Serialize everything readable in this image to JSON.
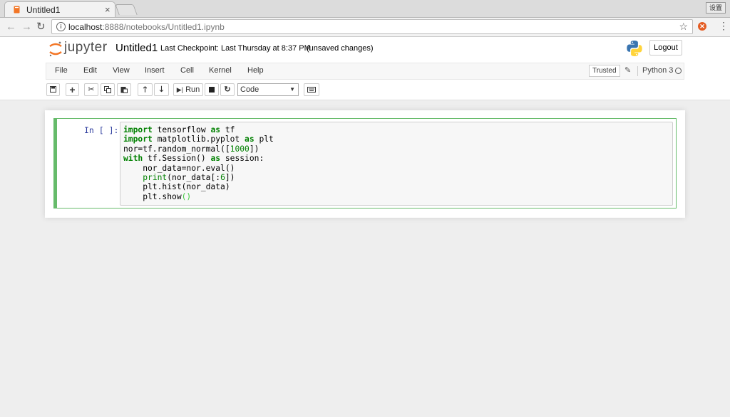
{
  "browser": {
    "tab_title": "Untitled1",
    "system_badge": "设置",
    "url_host": "localhost",
    "url_rest": ":8888/notebooks/Untitled1.ipynb"
  },
  "header": {
    "logo_text": "jupyter",
    "notebook_name": "Untitled1",
    "checkpoint": "Last Checkpoint: Last Thursday at 8:37 PM",
    "unsaved": "(unsaved changes)",
    "logout_label": "Logout"
  },
  "menubar": {
    "items": [
      "File",
      "Edit",
      "View",
      "Insert",
      "Cell",
      "Kernel",
      "Help"
    ],
    "trusted_label": "Trusted",
    "kernel_name": "Python 3"
  },
  "toolbar": {
    "run_label": "Run",
    "cell_type": "Code"
  },
  "cell": {
    "prompt": "In [ ]:"
  },
  "colors": {
    "cell_border": "#66bb6a",
    "keyword": "#008000",
    "prompt": "#303f9f"
  }
}
